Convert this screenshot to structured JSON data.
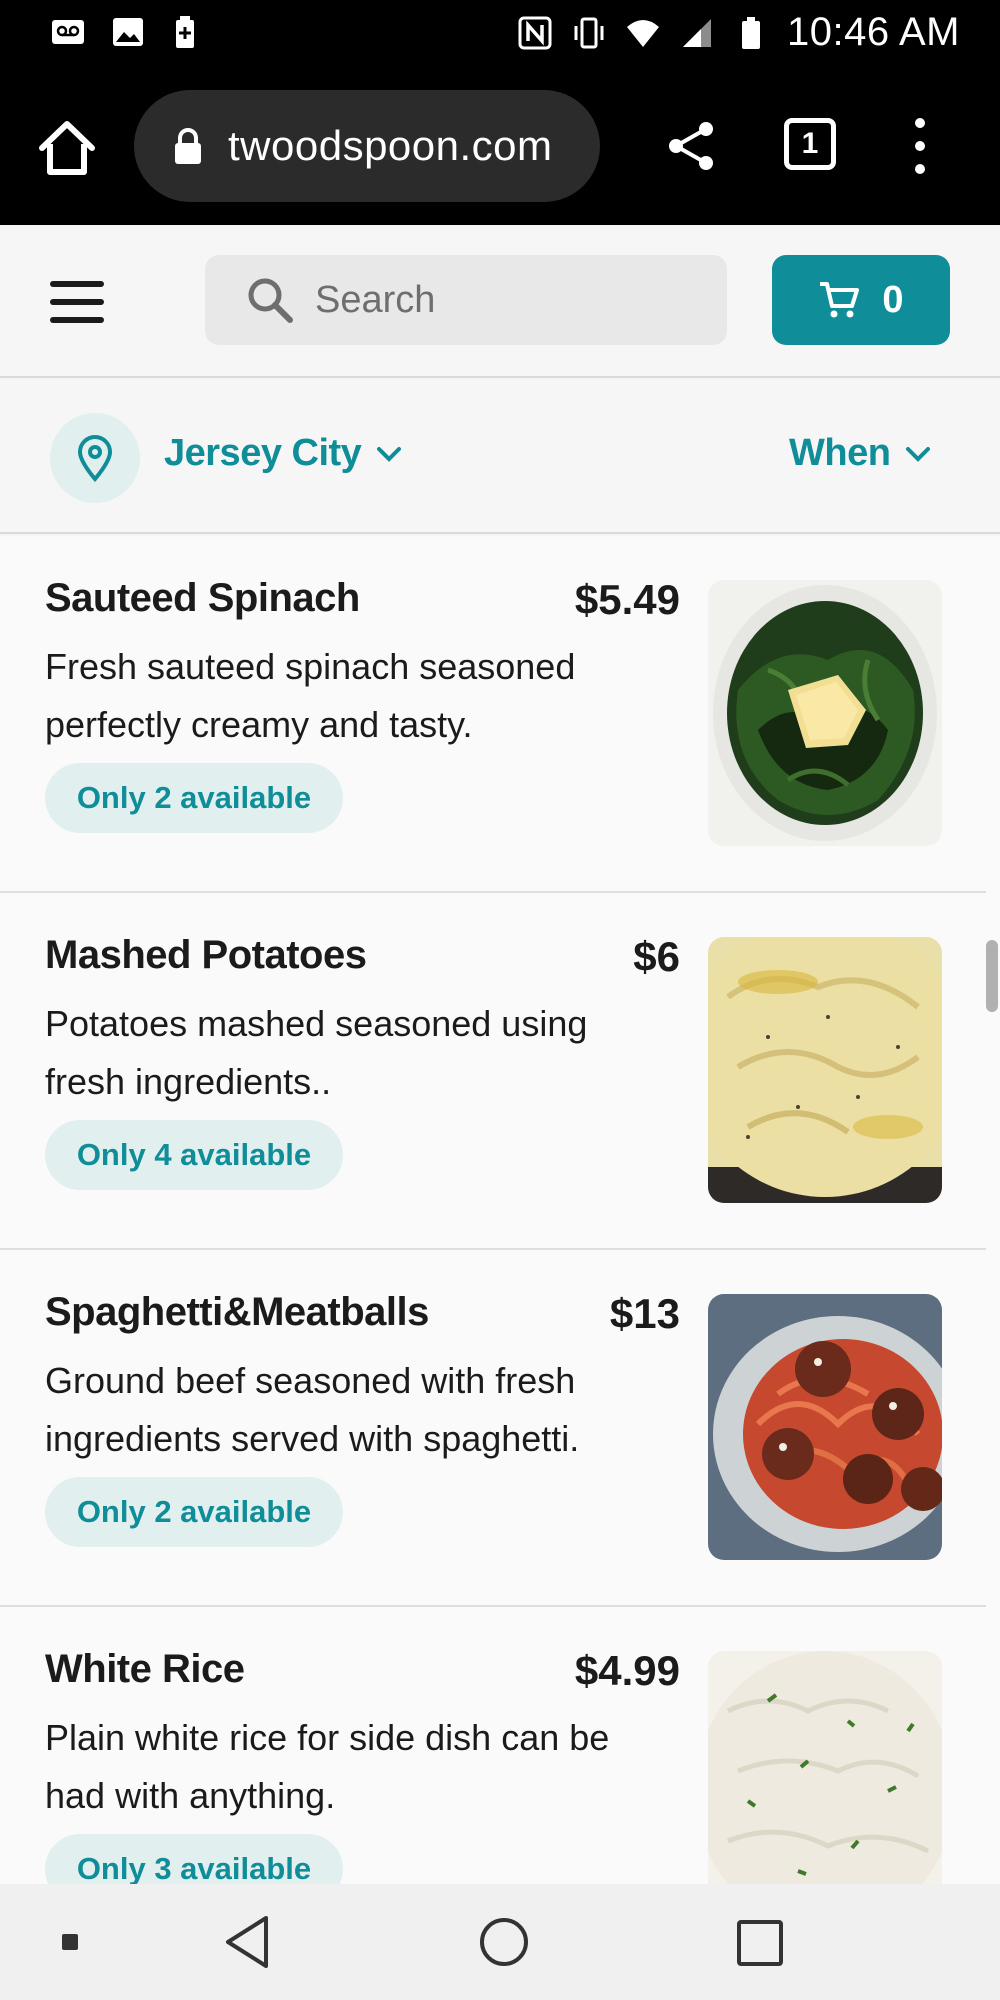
{
  "status_bar": {
    "time": "10:46 AM",
    "left_icons": [
      "voicemail-icon",
      "image-icon",
      "battery-saver-icon"
    ],
    "right_icons": [
      "nfc-icon",
      "vibrate-icon",
      "wifi-icon",
      "signal-icon",
      "battery-icon"
    ]
  },
  "browser": {
    "url": "twoodspoon.com",
    "tab_count": "1"
  },
  "header": {
    "search_placeholder": "Search",
    "cart_count": "0",
    "accent_color": "#0f8d98"
  },
  "location": {
    "city": "Jersey City",
    "when_label": "When"
  },
  "menu": {
    "items": [
      {
        "name": "Sauteed Spinach",
        "price": "$5.49",
        "description": "Fresh sauteed spinach seasoned perfectly creamy and tasty.",
        "availability": "Only 2 available",
        "image": "sauteed-spinach-photo"
      },
      {
        "name": "Mashed Potatoes",
        "price": "$6",
        "description": "Potatoes mashed seasoned using fresh ingredients..",
        "availability": "Only 4 available",
        "image": "mashed-potatoes-photo"
      },
      {
        "name": "Spaghetti&Meatballs",
        "price": "$13",
        "description": "Ground beef seasoned with fresh ingredients served with spaghetti.",
        "availability": "Only 2 available",
        "image": "spaghetti-meatballs-photo"
      },
      {
        "name": "White Rice",
        "price": "$4.99",
        "description": "Plain white rice for side dish can be had with anything.",
        "availability": "Only 3 available",
        "image": "white-rice-photo"
      }
    ]
  }
}
